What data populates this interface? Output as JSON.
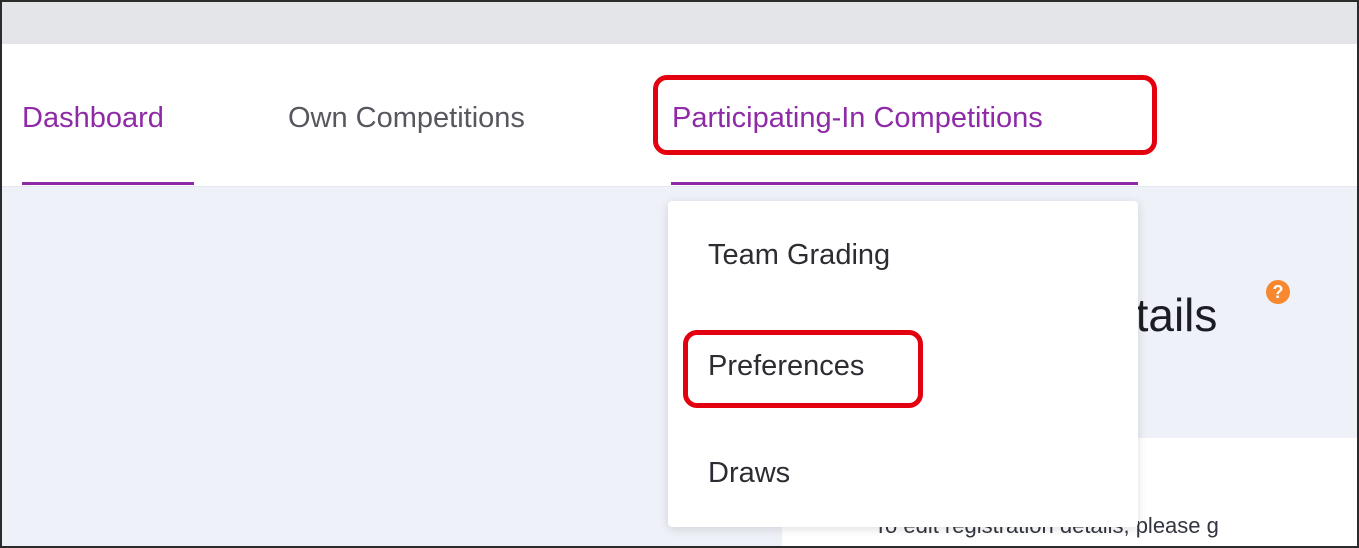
{
  "nav": {
    "items": [
      {
        "label": "Dashboard",
        "active": true
      },
      {
        "label": "Own Competitions",
        "active": false
      },
      {
        "label": "Participating-In Competitions",
        "active": true
      }
    ]
  },
  "dropdown": {
    "items": [
      {
        "label": "Team Grading"
      },
      {
        "label": "Preferences",
        "highlighted": true
      },
      {
        "label": "Draws"
      }
    ]
  },
  "content": {
    "heading_partial": "etails",
    "help_icon": "?",
    "instruction_partial": "To edit registration details, please g"
  },
  "colors": {
    "accent": "#8f2aa7",
    "highlight": "#e3000f",
    "help": "#f7882f"
  }
}
